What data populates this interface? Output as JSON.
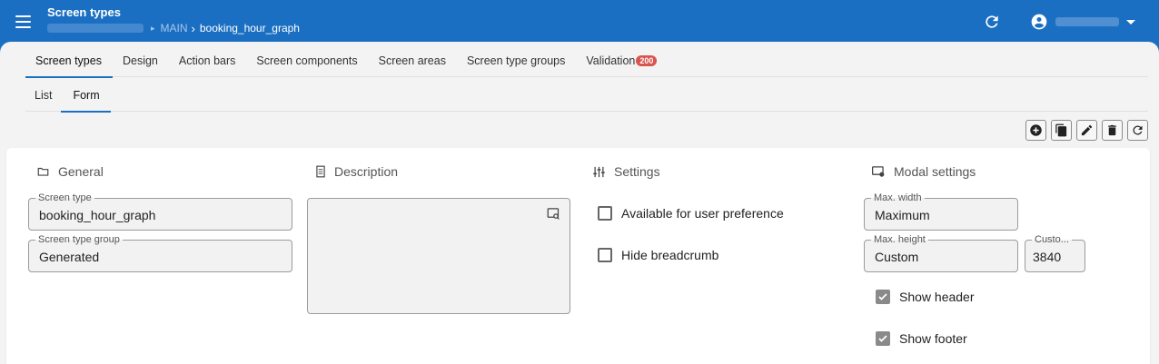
{
  "topbar": {
    "title": "Screen types",
    "breadcrumb_main": "MAIN",
    "breadcrumb_current": "booking_hour_graph"
  },
  "tabs_primary": [
    {
      "label": "Screen types",
      "active": true
    },
    {
      "label": "Design"
    },
    {
      "label": "Action bars"
    },
    {
      "label": "Screen components"
    },
    {
      "label": "Screen areas"
    },
    {
      "label": "Screen type groups"
    },
    {
      "label": "Validation",
      "badge": "200"
    }
  ],
  "tabs_secondary": [
    {
      "label": "List"
    },
    {
      "label": "Form",
      "active": true
    }
  ],
  "toolbar": {
    "icons": [
      "add-circle-icon",
      "copy-icon",
      "edit-icon",
      "delete-icon",
      "refresh-icon"
    ]
  },
  "general": {
    "heading": "General",
    "screen_type_label": "Screen type",
    "screen_type_value": "booking_hour_graph",
    "screen_type_group_label": "Screen type group",
    "screen_type_group_value": "Generated"
  },
  "description": {
    "heading": "Description",
    "value": ""
  },
  "settings": {
    "heading": "Settings",
    "available_label": "Available for user preference",
    "available_checked": false,
    "hide_breadcrumb_label": "Hide breadcrumb",
    "hide_breadcrumb_checked": false
  },
  "modal": {
    "heading": "Modal settings",
    "max_width_label": "Max. width",
    "max_width_value": "Maximum",
    "max_height_label": "Max. height",
    "max_height_value": "Custom",
    "custom_label": "Custo...",
    "custom_value": "3840",
    "show_header_label": "Show header",
    "show_header_checked": true,
    "show_footer_label": "Show footer",
    "show_footer_checked": true
  },
  "colors": {
    "brand": "#1b6fc2",
    "badge": "#d9534f"
  }
}
